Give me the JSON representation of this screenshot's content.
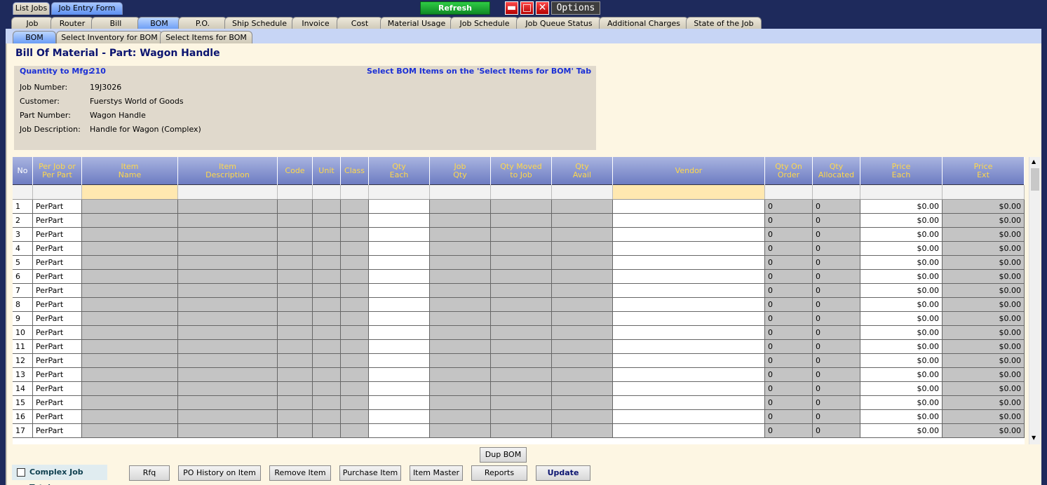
{
  "top_tabs": [
    "List Jobs",
    "Job Entry Form"
  ],
  "refresh_label": "Refresh",
  "options_label": "Options",
  "window_buttons": {
    "min": "▬",
    "max": "□",
    "close": "✕"
  },
  "module_tabs": [
    "Job",
    "Router",
    "Bill",
    "BOM",
    "P.O.",
    "Ship Schedule",
    "Invoice",
    "Cost",
    "Material Usage",
    "Job Schedule",
    "Job Queue Status",
    "Additional Charges",
    "State of the Job"
  ],
  "sub_tabs": [
    "BOM",
    "Select Inventory for BOM",
    "Select Items for BOM"
  ],
  "title": "Bill Of Material - Part: Wagon Handle",
  "info": {
    "qty_label": "Quantity to Mfg:",
    "qty_value": "210",
    "hint": "Select BOM Items on the 'Select Items for BOM' Tab",
    "job_number_label": "Job Number:",
    "job_number": "19J3026",
    "customer_label": "Customer:",
    "customer": "Fuerstys World of Goods",
    "part_number_label": "Part Number:",
    "part_number": "Wagon Handle",
    "job_desc_label": "Job Description:",
    "job_desc": "Handle for Wagon (Complex)"
  },
  "columns": [
    {
      "label": "No"
    },
    {
      "label": "Per Job or\nPer Part"
    },
    {
      "label": "Item\nName"
    },
    {
      "label": "Item\nDescription"
    },
    {
      "label": "Code"
    },
    {
      "label": "Unit"
    },
    {
      "label": "Class"
    },
    {
      "label": "Qty\nEach"
    },
    {
      "label": "Job\nQty"
    },
    {
      "label": "Qty Moved\nto Job"
    },
    {
      "label": "Qty\nAvail"
    },
    {
      "label": "Vendor"
    },
    {
      "label": "Qty On\nOrder"
    },
    {
      "label": "Qty\nAllocated"
    },
    {
      "label": "Price\nEach"
    },
    {
      "label": "Price\nExt"
    }
  ],
  "rows": [
    {
      "no": "1",
      "per": "PerPart",
      "qty_on_order": "0",
      "qty_allocated": "0",
      "price_each": "$0.00",
      "price_ext": "$0.00"
    },
    {
      "no": "2",
      "per": "PerPart",
      "qty_on_order": "0",
      "qty_allocated": "0",
      "price_each": "$0.00",
      "price_ext": "$0.00"
    },
    {
      "no": "3",
      "per": "PerPart",
      "qty_on_order": "0",
      "qty_allocated": "0",
      "price_each": "$0.00",
      "price_ext": "$0.00"
    },
    {
      "no": "4",
      "per": "PerPart",
      "qty_on_order": "0",
      "qty_allocated": "0",
      "price_each": "$0.00",
      "price_ext": "$0.00"
    },
    {
      "no": "5",
      "per": "PerPart",
      "qty_on_order": "0",
      "qty_allocated": "0",
      "price_each": "$0.00",
      "price_ext": "$0.00"
    },
    {
      "no": "6",
      "per": "PerPart",
      "qty_on_order": "0",
      "qty_allocated": "0",
      "price_each": "$0.00",
      "price_ext": "$0.00"
    },
    {
      "no": "7",
      "per": "PerPart",
      "qty_on_order": "0",
      "qty_allocated": "0",
      "price_each": "$0.00",
      "price_ext": "$0.00"
    },
    {
      "no": "8",
      "per": "PerPart",
      "qty_on_order": "0",
      "qty_allocated": "0",
      "price_each": "$0.00",
      "price_ext": "$0.00"
    },
    {
      "no": "9",
      "per": "PerPart",
      "qty_on_order": "0",
      "qty_allocated": "0",
      "price_each": "$0.00",
      "price_ext": "$0.00"
    },
    {
      "no": "10",
      "per": "PerPart",
      "qty_on_order": "0",
      "qty_allocated": "0",
      "price_each": "$0.00",
      "price_ext": "$0.00"
    },
    {
      "no": "11",
      "per": "PerPart",
      "qty_on_order": "0",
      "qty_allocated": "0",
      "price_each": "$0.00",
      "price_ext": "$0.00"
    },
    {
      "no": "12",
      "per": "PerPart",
      "qty_on_order": "0",
      "qty_allocated": "0",
      "price_each": "$0.00",
      "price_ext": "$0.00"
    },
    {
      "no": "13",
      "per": "PerPart",
      "qty_on_order": "0",
      "qty_allocated": "0",
      "price_each": "$0.00",
      "price_ext": "$0.00"
    },
    {
      "no": "14",
      "per": "PerPart",
      "qty_on_order": "0",
      "qty_allocated": "0",
      "price_each": "$0.00",
      "price_ext": "$0.00"
    },
    {
      "no": "15",
      "per": "PerPart",
      "qty_on_order": "0",
      "qty_allocated": "0",
      "price_each": "$0.00",
      "price_ext": "$0.00"
    },
    {
      "no": "16",
      "per": "PerPart",
      "qty_on_order": "0",
      "qty_allocated": "0",
      "price_each": "$0.00",
      "price_ext": "$0.00"
    },
    {
      "no": "17",
      "per": "PerPart",
      "qty_on_order": "0",
      "qty_allocated": "0",
      "price_each": "$0.00",
      "price_ext": "$0.00"
    }
  ],
  "buttons": {
    "dup_bom": "Dup BOM",
    "rfq": "Rfq",
    "po_history": "PO History on Item",
    "remove_item": "Remove Item",
    "purchase_item": "Purchase Item",
    "item_master": "Item Master",
    "reports": "Reports",
    "update": "Update"
  },
  "complex_job_totals_label": "Complex Job Totals",
  "scroll_icons": {
    "up": "▲",
    "down": "▼"
  }
}
